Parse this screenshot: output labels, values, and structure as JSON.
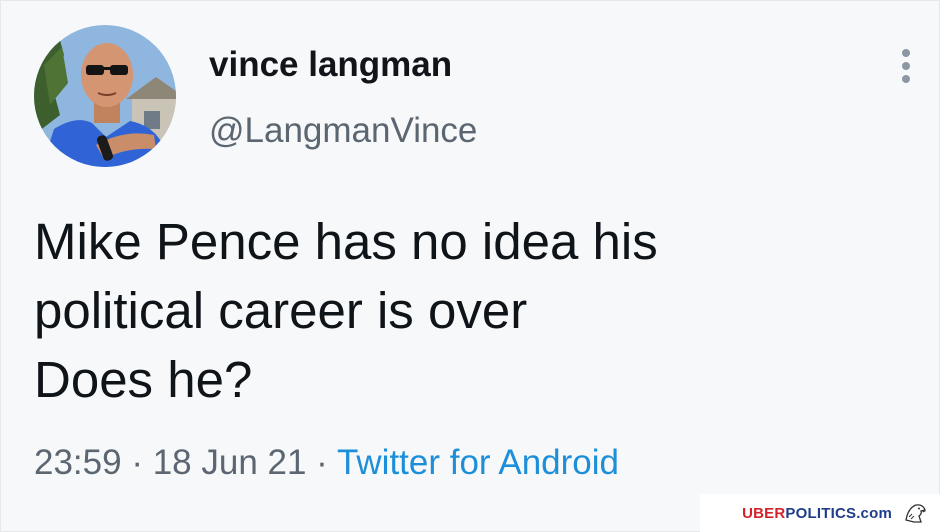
{
  "tweet": {
    "display_name": "vince langman",
    "handle": "@LangmanVince",
    "text_lines": [
      "Mike Pence has no idea his",
      "political career is over",
      "Does he?"
    ],
    "time": "23:59",
    "separator": " · ",
    "date": "18 Jun 21",
    "source": "Twitter for Android"
  },
  "watermark": {
    "uber": "UBER",
    "politics": "POLITICS",
    "com": ".com"
  },
  "icons": {
    "more": "more-vertical-icon",
    "logo": "eagle-icon"
  },
  "colors": {
    "link": "#1d8fd9",
    "secondary_text": "#5b6671",
    "watermark_red": "#d2232a",
    "watermark_blue": "#1f3d8a"
  }
}
